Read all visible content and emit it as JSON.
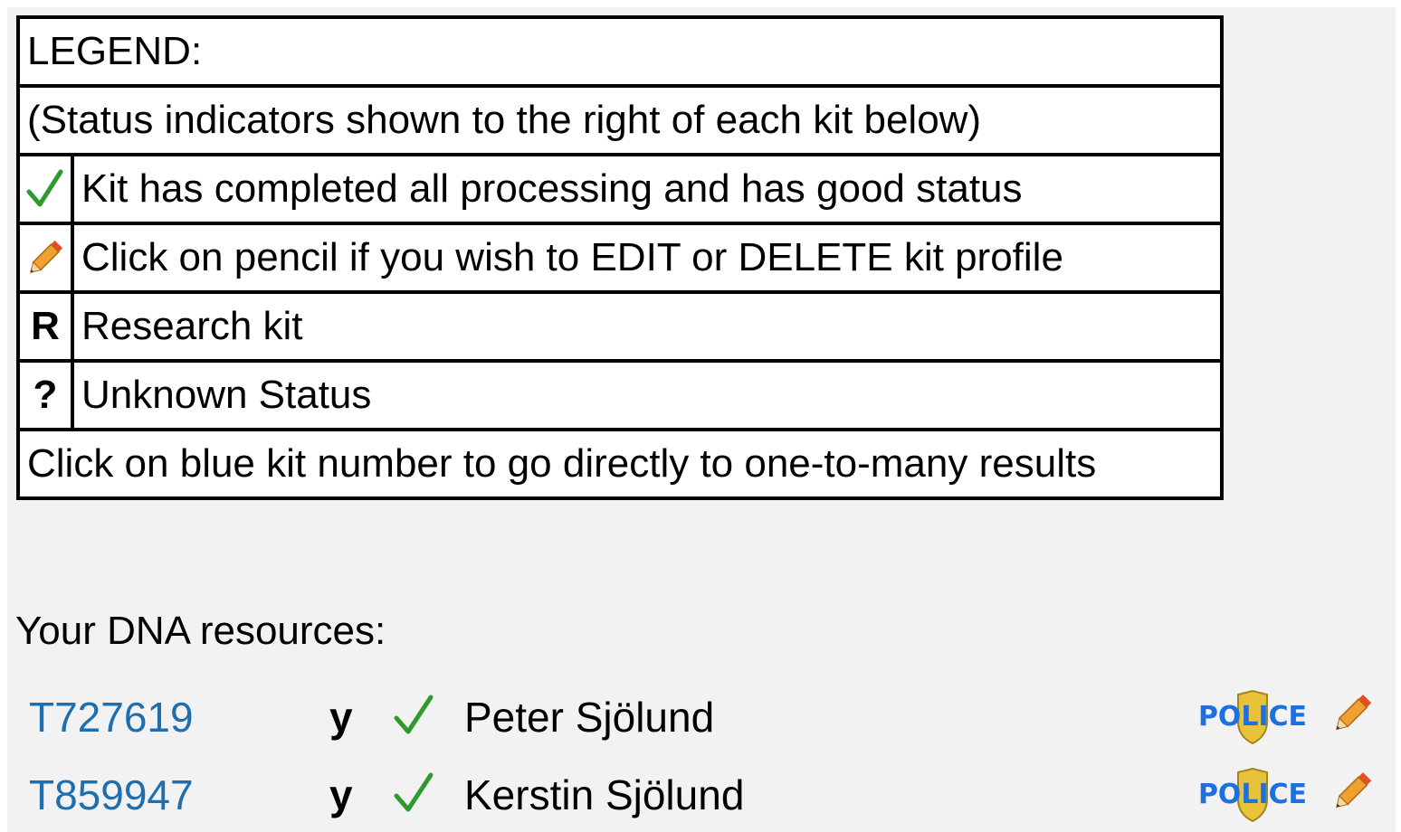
{
  "legend": {
    "title": "LEGEND:",
    "subtitle": "(Status indicators shown to the right of each kit below)",
    "rows": [
      {
        "icon": "checkmark-icon",
        "text": "Kit has completed all processing and has good status"
      },
      {
        "icon": "pencil-icon",
        "text": "Click on pencil if you wish to EDIT or DELETE kit profile"
      },
      {
        "symbol": "R",
        "text": "Research kit"
      },
      {
        "symbol": "?",
        "text": "Unknown Status"
      }
    ],
    "footer": "Click on blue kit number to go directly to one-to-many results"
  },
  "resources": {
    "title": "Your DNA resources:",
    "kits": [
      {
        "id": "T727619",
        "flag": "y",
        "status_icon": "checkmark-icon",
        "name": "Peter Sjölund",
        "badge": "police-badge-icon",
        "edit_icon": "pencil-icon"
      },
      {
        "id": "T859947",
        "flag": "y",
        "status_icon": "checkmark-icon",
        "name": "Kerstin Sjölund",
        "badge": "police-badge-icon",
        "edit_icon": "pencil-icon"
      }
    ]
  },
  "colors": {
    "link": "#1f6fae",
    "check": "#2e9a2e",
    "police_blue": "#1e6fe0",
    "police_gold": "#e8c23a",
    "pencil_body": "#f0a030",
    "pencil_tip": "#e05020"
  }
}
